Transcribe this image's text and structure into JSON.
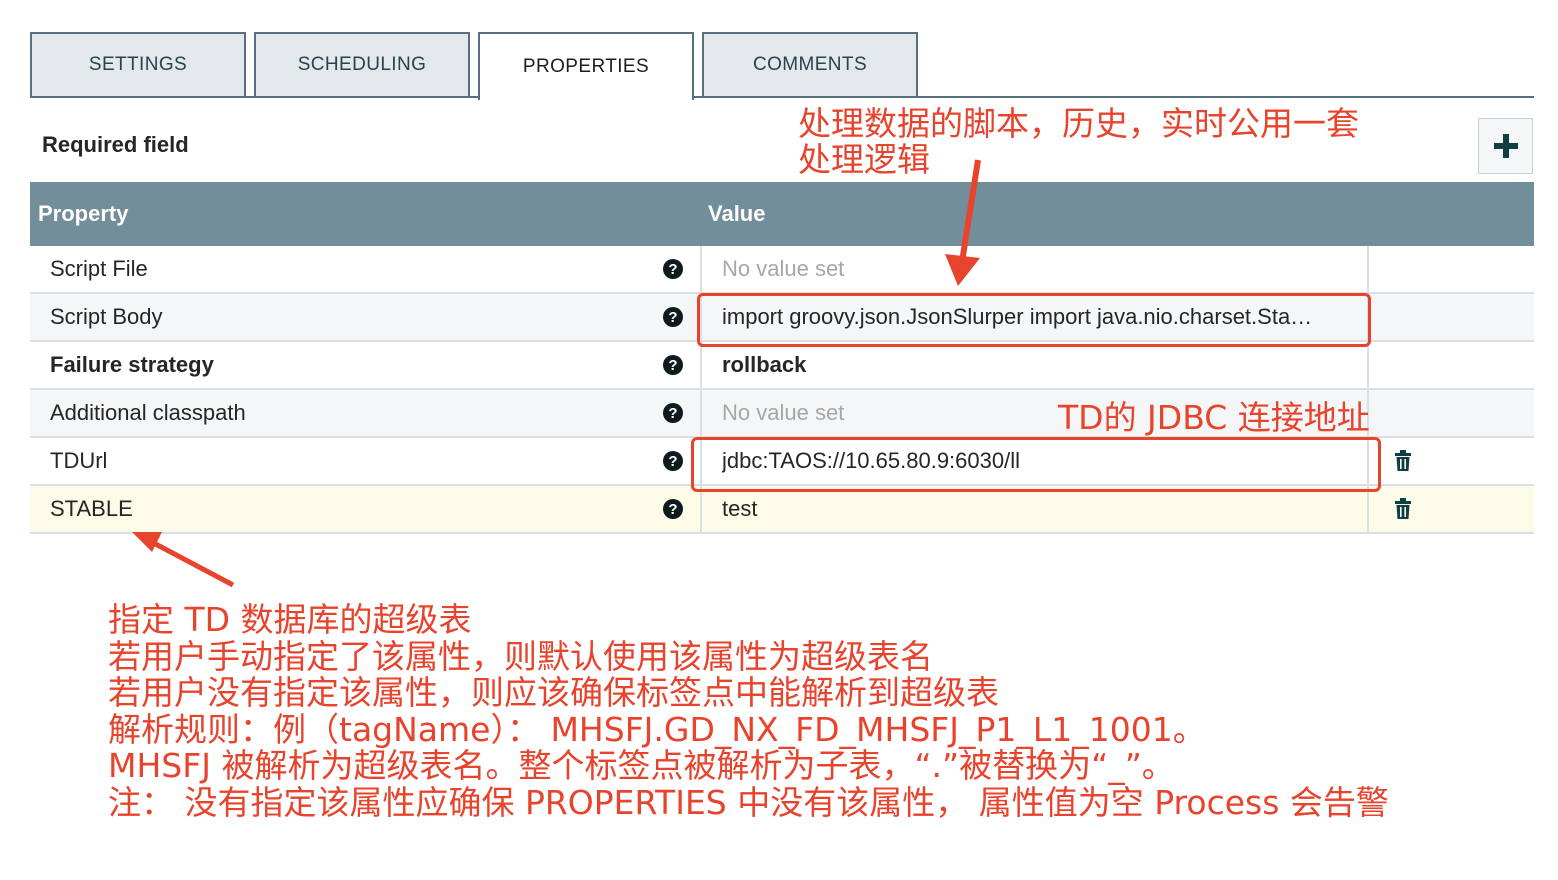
{
  "tabs": [
    {
      "label": "SETTINGS",
      "active": false
    },
    {
      "label": "SCHEDULING",
      "active": false
    },
    {
      "label": "PROPERTIES",
      "active": true
    },
    {
      "label": "COMMENTS",
      "active": false
    }
  ],
  "required_field_label": "Required field",
  "add_button_icon": "plus-icon",
  "table": {
    "headers": {
      "property": "Property",
      "value": "Value"
    },
    "rows": [
      {
        "property": "Script File",
        "value": "No value set",
        "required": false,
        "empty": true,
        "deletable": false
      },
      {
        "property": "Script Body",
        "value": "import groovy.json.JsonSlurper import java.nio.charset.Sta…",
        "required": false,
        "empty": false,
        "deletable": false
      },
      {
        "property": "Failure strategy",
        "value": "rollback",
        "required": true,
        "empty": false,
        "deletable": false
      },
      {
        "property": "Additional classpath",
        "value": "No value set",
        "required": false,
        "empty": true,
        "deletable": false
      },
      {
        "property": "TDUrl",
        "value": "jdbc:TAOS://10.65.80.9:6030/ll",
        "required": false,
        "empty": false,
        "deletable": true
      },
      {
        "property": "STABLE",
        "value": "test",
        "required": false,
        "empty": false,
        "deletable": true
      }
    ]
  },
  "annotations": {
    "script_note": [
      "处理数据的脚本，历史，实时公用一套",
      "处理逻辑"
    ],
    "tdurl_note": "TD的 JDBC 连接地址",
    "stable_note": [
      "指定 TD 数据库的超级表",
      "若用户手动指定了该属性，则默认使用该属性为超级表名",
      "若用户没有指定该属性，则应该确保标签点中能解析到超级表",
      "解析规则：例（tagName）：  MHSFJ.GD_NX_FD_MHSFJ_P1_L1_1001。",
      "MHSFJ 被解析为超级表名。整个标签点被解析为子表，“.”被替换为“_”。",
      "注：  没有指定该属性应确保 PROPERTIES 中没有该属性，  属性值为空 Process 会告警"
    ]
  },
  "colors": {
    "header_bg": "#728e9b",
    "tab_border": "#55707e",
    "annotation": "#e8432c",
    "highlight_row": "#fcfbe8"
  }
}
